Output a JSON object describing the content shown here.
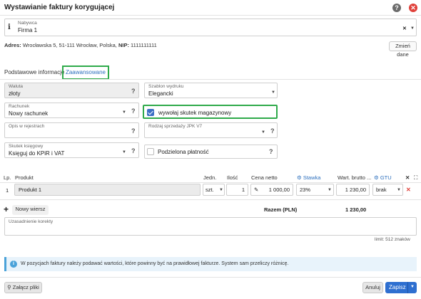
{
  "window": {
    "title": "Wystawianie faktury korygującej",
    "help_icon": "?",
    "close_icon": "✕"
  },
  "buyer": {
    "label": "Nabywca",
    "value": "Firma 1",
    "clear": "✕",
    "caret": "▼"
  },
  "address": {
    "prefix": "Adres:",
    "text": " Wrocławska 5, 51-111 Wrocław, Polska,",
    "nip_label": " NIP:",
    "nip": " 1111111111"
  },
  "change_button": "Zmień dane",
  "tabs": [
    {
      "label": "Podstawowe informacje"
    },
    {
      "label": "Zaawansowane"
    }
  ],
  "form": {
    "currency": {
      "label": "Waluta",
      "value": "złoty"
    },
    "template": {
      "label": "Szablon wydruku",
      "value": "Elegancki"
    },
    "account": {
      "label": "Rachunek",
      "value": "Nowy rachunek"
    },
    "warehouse": {
      "label": "wywołaj skutek magazynowy",
      "checked": true
    },
    "register_desc": {
      "label": "Opis w rejestrach",
      "value": ""
    },
    "jpk": {
      "label": "Rodzaj sprzedaży JPK V7",
      "value": ""
    },
    "accounting": {
      "label": "Skutek księgowy",
      "value": "Księguj do KPiR i VAT"
    },
    "split": {
      "label": "Podzielona płatność",
      "checked": false
    },
    "help": "?"
  },
  "table": {
    "headers": {
      "lp": "Lp.",
      "product": "Produkt",
      "unit": "Jedn.",
      "qty": "Ilość",
      "net_price": "Cena netto",
      "rate": "Stawka",
      "gross_value": "Wart. brutto ...",
      "gtu": "GTU",
      "close": "✕",
      "expand": "⛶"
    },
    "rows": [
      {
        "lp": "1",
        "product": "Produkt 1",
        "unit": "szt.",
        "qty": "1",
        "net_price": "1 000,00",
        "rate": "23%",
        "gross_value": "1 230,00",
        "gtu": "brak",
        "delete": "✕"
      }
    ],
    "new_row_plus": "+",
    "new_row_label": "Nowy wiersz",
    "total_label": "Razem (PLN)",
    "total_value": "1 230,00"
  },
  "justification": {
    "label": "Uzasadnienie korekty",
    "value": "",
    "limit": "limit: 512 znaków"
  },
  "info": {
    "text": "W pozycjach faktury należy podawać wartości, które powinny być na prawidłowej fakturze. System sam przeliczy różnicę."
  },
  "footer": {
    "attach": "Załącz pliki",
    "cancel": "Anuluj",
    "save": "Zapisz"
  }
}
